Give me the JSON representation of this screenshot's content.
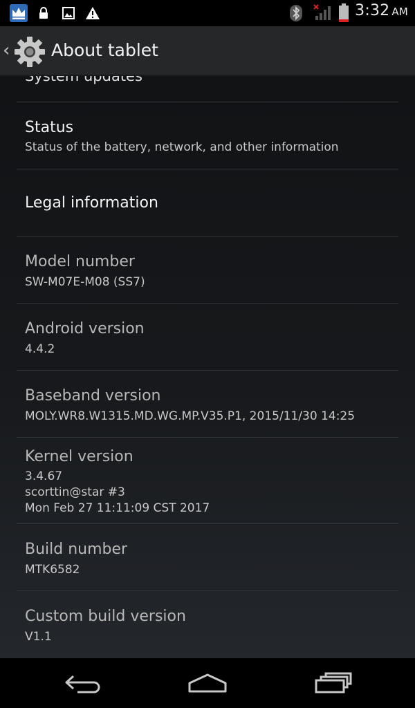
{
  "status_bar": {
    "time": "3:32",
    "ampm": "AM",
    "left_icons": [
      "crown-icon",
      "lock-icon",
      "image-icon",
      "warning-icon"
    ],
    "right_icons": [
      "bluetooth-icon",
      "signal-icon",
      "battery-icon"
    ]
  },
  "action_bar": {
    "title": "About tablet",
    "icon": "settings-gear-icon"
  },
  "list": {
    "partial_top_label": "System updates",
    "items": [
      {
        "title": "Status",
        "summary": "Status of the battery, network, and other information"
      },
      {
        "title": "Legal information",
        "summary": ""
      },
      {
        "title": "Model number",
        "summary": "SW-M07E-M08 (SS7)"
      },
      {
        "title": "Android version",
        "summary": "4.4.2"
      },
      {
        "title": "Baseband version",
        "summary": "MOLY.WR8.W1315.MD.WG.MP.V35.P1, 2015/11/30 14:25"
      },
      {
        "title": "Kernel version",
        "summary": "3.4.67\nscorttin@star #3\nMon Feb 27 11:11:09 CST 2017"
      },
      {
        "title": "Build number",
        "summary": "MTK6582"
      },
      {
        "title": "Custom build version",
        "summary": "V1.1"
      }
    ]
  },
  "nav_bar": {
    "buttons": [
      "back-icon",
      "home-icon",
      "recents-icon"
    ]
  },
  "colors": {
    "background_top": "#101113",
    "background_bottom": "#262a2f",
    "actionbar": "#262729",
    "divider": "#33373b",
    "title_active": "#f4f4f4",
    "title_disabled": "#b8b8b8",
    "summary": "#c9c9c9"
  }
}
